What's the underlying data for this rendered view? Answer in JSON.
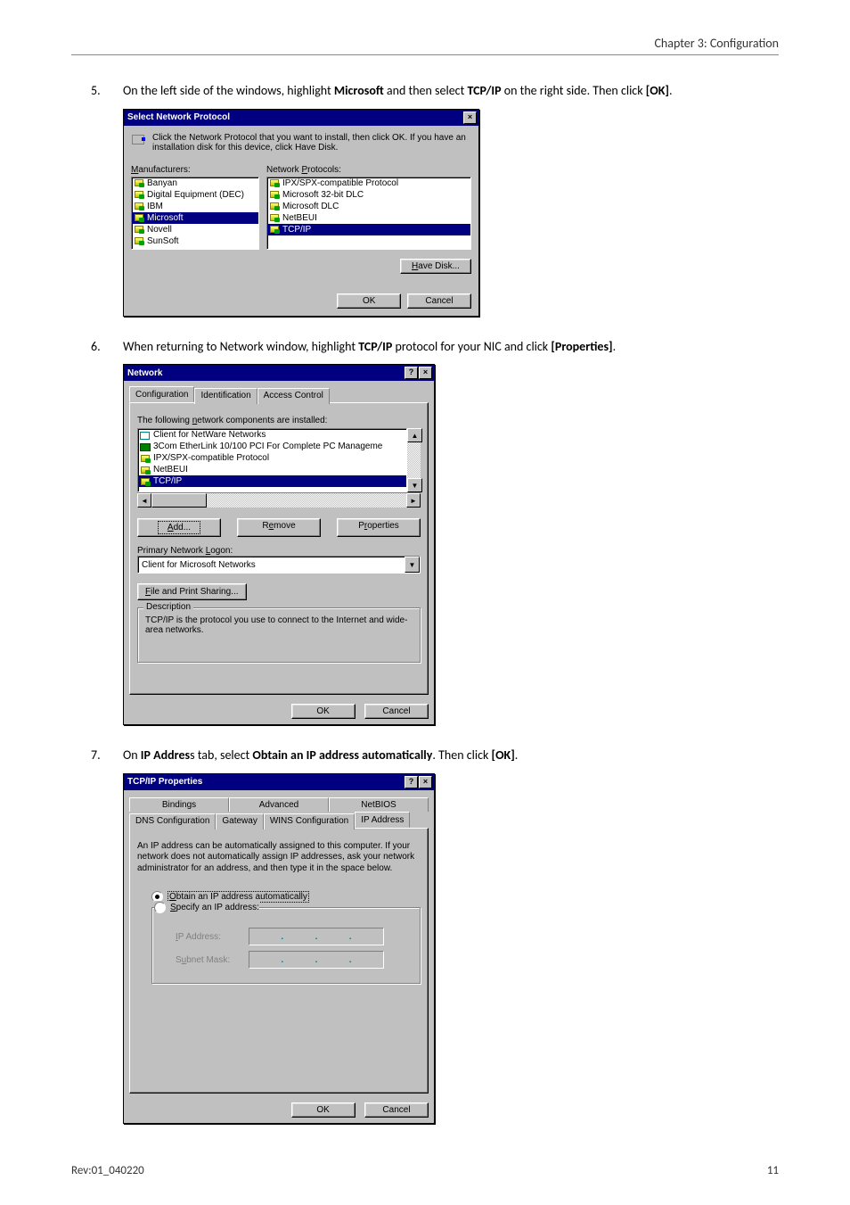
{
  "chapter_header": "Chapter 3: Configuration",
  "step5": {
    "num": "5.",
    "text_pre": "On the left side of the windows, highlight ",
    "bold1": "Microsoft",
    "text_mid": " and then select ",
    "bold2": "TCP/IP",
    "text_post": " on the right side. Then click ",
    "bold3": "[OK]",
    "text_end": "."
  },
  "step6": {
    "num": "6.",
    "text_pre": "When returning to Network window, highlight ",
    "bold1": "TCP/IP",
    "text_mid": " protocol for your NIC and click ",
    "bold2": "[Properties]",
    "text_end": "."
  },
  "step7": {
    "num": "7.",
    "text_pre": "On ",
    "bold1": "IP Addres",
    "text_mid1": "s tab, select ",
    "bold2": "Obtain an IP address automatically",
    "text_mid2": ". Then click ",
    "bold3": "[OK]",
    "text_end": "."
  },
  "dlg1": {
    "title": "Select Network Protocol",
    "instruction": "Click the Network Protocol that you want to install, then click OK. If you have an installation disk for this device, click Have Disk.",
    "col1_label": "Manufacturers:",
    "col2_label": "Network Protocols:",
    "manufacturers": [
      "Banyan",
      "Digital Equipment (DEC)",
      "IBM",
      "Microsoft",
      "Novell",
      "SunSoft"
    ],
    "protocols": [
      "IPX/SPX-compatible Protocol",
      "Microsoft 32-bit DLC",
      "Microsoft DLC",
      "NetBEUI",
      "TCP/IP"
    ],
    "selected_manufacturer_index": 3,
    "selected_protocol_index": 4,
    "btn_havedisk": "Have Disk...",
    "btn_ok": "OK",
    "btn_cancel": "Cancel"
  },
  "dlg2": {
    "title": "Network",
    "tabs": [
      "Configuration",
      "Identification",
      "Access Control"
    ],
    "active_tab": 0,
    "label_installed": "The following network components are installed:",
    "components": [
      {
        "icon": "net",
        "text": "Client for NetWare Networks"
      },
      {
        "icon": "adapter",
        "text": "3Com EtherLink 10/100 PCI For Complete PC Manageme"
      },
      {
        "icon": "proto",
        "text": "IPX/SPX-compatible Protocol"
      },
      {
        "icon": "proto",
        "text": "NetBEUI"
      },
      {
        "icon": "proto",
        "text": "TCP/IP",
        "selected": true
      }
    ],
    "btn_add": "Add...",
    "btn_remove": "Remove",
    "btn_properties": "Properties",
    "label_primary": "Primary Network Logon:",
    "primary_value": "Client for Microsoft Networks",
    "btn_fileshare": "File and Print Sharing...",
    "group_description": "Description",
    "description_text": "TCP/IP is the protocol you use to connect to the Internet and wide-area networks.",
    "btn_ok": "OK",
    "btn_cancel": "Cancel"
  },
  "dlg3": {
    "title": "TCP/IP Properties",
    "tabs_row1": [
      "Bindings",
      "Advanced",
      "NetBIOS"
    ],
    "tabs_row2": [
      "DNS Configuration",
      "Gateway",
      "WINS Configuration",
      "IP Address"
    ],
    "active_tab": 3,
    "info_text": "An IP address can be automatically assigned to this computer. If your network does not automatically assign IP addresses, ask your network administrator for an address, and then type it in the space below.",
    "radio_obtain": "Obtain an IP address automatically",
    "radio_specify": "Specify an IP address:",
    "label_ipaddress": "IP Address:",
    "label_subnet": "Subnet Mask:",
    "btn_ok": "OK",
    "btn_cancel": "Cancel"
  },
  "footer": {
    "left": "Rev:01_040220",
    "right": "11"
  }
}
